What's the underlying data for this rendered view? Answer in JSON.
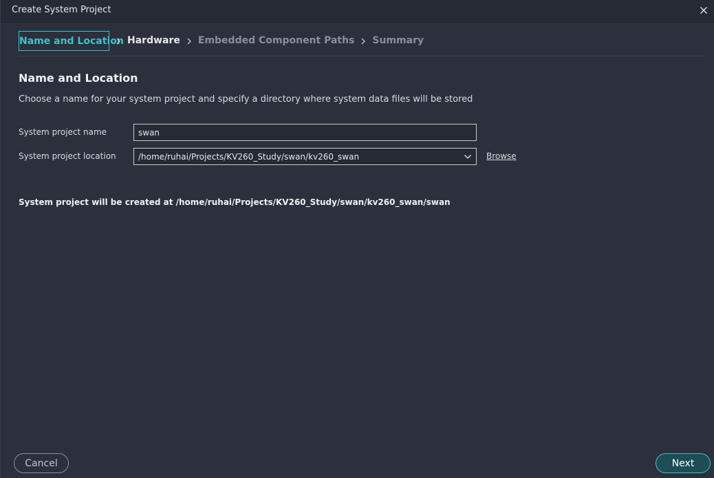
{
  "window": {
    "title": "Create System Project",
    "close_icon": "close-icon"
  },
  "steps": [
    {
      "label": "Name and Location",
      "state": "active"
    },
    {
      "label": "Hardware",
      "state": "next"
    },
    {
      "label": "Embedded Component Paths",
      "state": "disabled"
    },
    {
      "label": "Summary",
      "state": "disabled"
    }
  ],
  "section": {
    "title": "Name and Location",
    "description": "Choose a name for your system project and specify a directory where system data files will be stored"
  },
  "form": {
    "name_label": "System project name",
    "name_value": "swan",
    "location_label": "System project location",
    "location_value": "/home/ruhai/Projects/KV260_Study/swan/kv260_swan",
    "browse_label": "Browse"
  },
  "result": {
    "text": "System project will be created at /home/ruhai/Projects/KV260_Study/swan/kv260_swan/swan"
  },
  "footer": {
    "cancel_label": "Cancel",
    "next_label": "Next"
  },
  "colors": {
    "accent": "#3ec1c9",
    "background": "#2b303c",
    "titlebar": "#262a34"
  }
}
